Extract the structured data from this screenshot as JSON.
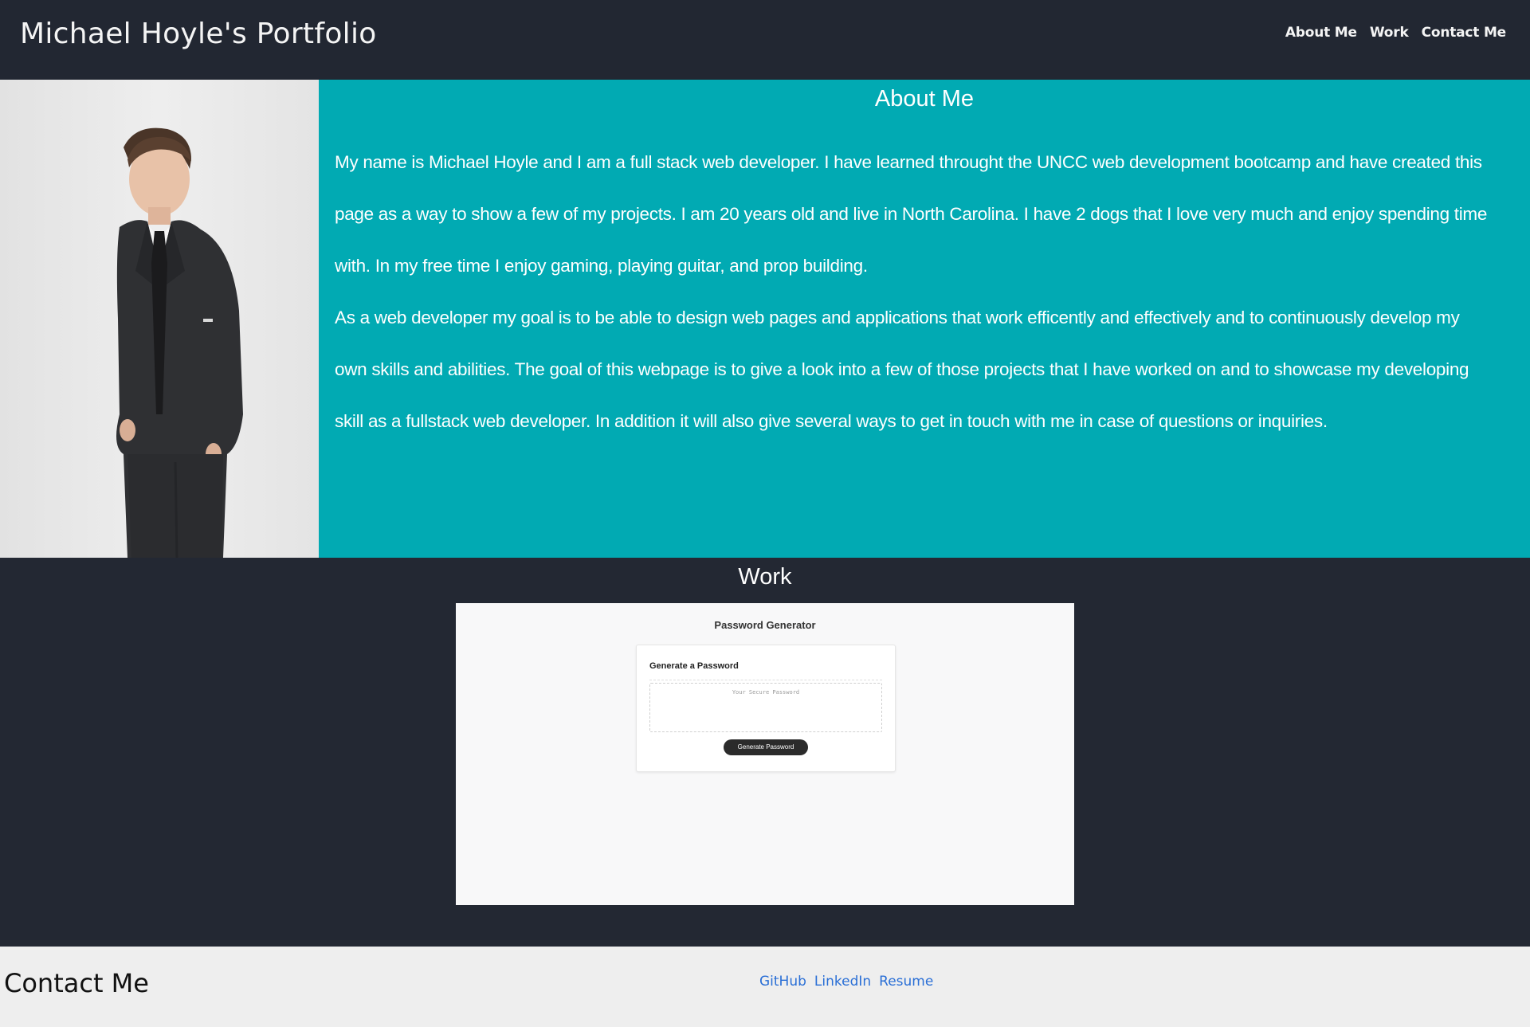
{
  "header": {
    "title": "Michael Hoyle's Portfolio",
    "nav": [
      "About Me",
      "Work",
      "Contact Me"
    ]
  },
  "about": {
    "title": "About Me",
    "paragraphs": [
      "My name is Michael Hoyle and I am a full stack web developer. I have learned throught the UNCC web development bootcamp and have created this page as a way to show a few of my projects. I am 20 years old and live in North Carolina. I have 2 dogs that I love very much and enjoy spending time with. In my free time I enjoy gaming, playing guitar, and prop building.",
      "As a web developer my goal is to be able to design web pages and applications that work efficently and effectively and to continuously develop my own skills and abilities. The goal of this webpage is to give a look into a few of those projects that I have worked on and to showcase my developing skill as a fullstack web developer. In addition it will also give several ways to get in touch with me in case of questions or inquiries."
    ]
  },
  "work": {
    "title": "Work",
    "project": {
      "page_title": "Password Generator",
      "card_title": "Generate a Password",
      "placeholder": "Your Secure Password",
      "button_label": "Generate Password"
    }
  },
  "contact": {
    "title": "Contact Me",
    "links": [
      "GitHub",
      "LinkedIn",
      "Resume"
    ]
  },
  "colors": {
    "dark_background": "#232833",
    "about_background": "#01aab3",
    "contact_background": "#eeeeee",
    "link": "#2a6fd6"
  },
  "icons": {
    "portrait": "profile-photo"
  }
}
